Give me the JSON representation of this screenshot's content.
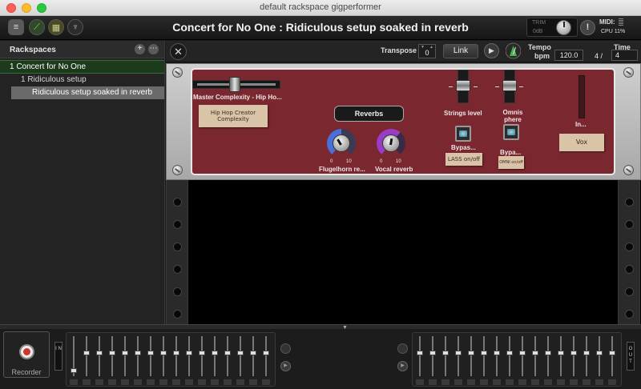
{
  "window": {
    "title": "default rackspace gigperformer"
  },
  "header": {
    "title": "Concert for No One : Ridiculous setup soaked in reverb",
    "trim_label": "TRIM",
    "trim_value": "0dB",
    "midi_label": "MIDI:",
    "cpu_label": "CPU  11%"
  },
  "sidebar": {
    "title": "Rackspaces",
    "items": [
      {
        "label": "1 Concert for No One"
      },
      {
        "label": "1  Ridiculous setup"
      },
      {
        "label": "Ridiculous setup soaked in reverb"
      }
    ]
  },
  "toolbar": {
    "transpose_label": "Transpose",
    "transpose_value": "0",
    "link_label": "Link",
    "tempo_label": "Tempo",
    "bpm_label": "bpm",
    "tempo_value": "120.0",
    "time_label": "Time",
    "time_numerator": "4 /",
    "time_denominator": "4"
  },
  "panel": {
    "master_complexity_label": "Master Complexity - Hip Ho...",
    "hip_hop_note": "Hip Hop Creator Complexity",
    "reverbs_label": "Reverbs",
    "knob1_label": "Flugelhorn re...",
    "knob2_label": "Vocal reverb",
    "knob_min": "0",
    "knob_max": "10",
    "strings_label": "Strings level",
    "omnisphere_label": "Omnis phere S...",
    "bypass1_label": "Bypas...",
    "lass_note": "LASS on/off",
    "bypass2_label": "Bypa...",
    "bypass2_note": "OMNI on/off",
    "meter_label": "In...",
    "vox_note": "Vox"
  },
  "mixer": {
    "recorder_label": "Recorder",
    "in_label": "I N",
    "out_label": "O U T"
  },
  "colors": {
    "panel": "#7a2730",
    "sidebar_active": "#1c3a1c",
    "sidebar_selected": "#6a6a6a"
  }
}
